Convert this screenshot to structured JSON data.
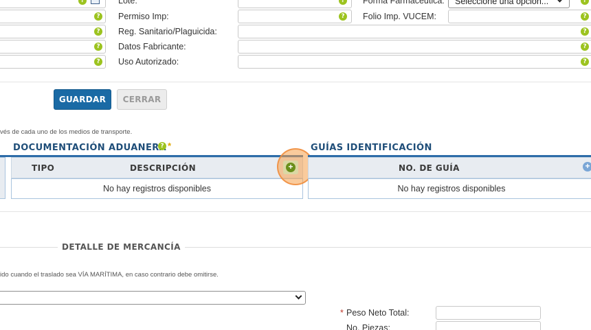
{
  "form": {
    "labels": {
      "lote": "Lote:",
      "permiso_imp": "Permiso Imp:",
      "reg_sanitario": "Reg. Sanitario/Plaguicida:",
      "datos_fabricante": "Datos Fabricante:",
      "uso_autorizado": "Uso Autorizado:",
      "forma_farmaceutica": "Forma Farmacéutica:",
      "folio_imp_vucem": "Folio Imp. VUCEM:"
    },
    "forma_farmaceutica_select": "Seleccione una opción...",
    "help_glyph": "?"
  },
  "buttons": {
    "guardar": "GUARDAR",
    "cerrar": "CERRAR"
  },
  "notes": {
    "transport": "vés de cada uno de los medios de transporte.",
    "maritima": "ido cuando el traslado sea VÍA MARÍTIMA, en caso contrario debe omitirse."
  },
  "documentacion": {
    "title": "DOCUMENTACIÓN ADUANERA",
    "required_mark": "*",
    "columns": [
      "TIPO",
      "DESCRIPCIÓN"
    ],
    "empty": "No hay registros disponibles",
    "add_glyph": "+"
  },
  "guias": {
    "title": "GUÍAS IDENTIFICACIÓN",
    "columns": [
      "NO. DE GUÍA"
    ],
    "empty": "No hay registros disponibles"
  },
  "detalle": {
    "legend": "DETALLE DE MERCANCÍA",
    "required_mark": "*",
    "peso_neto_label": "Peso Neto Total:",
    "no_piezas_label": "No. Piezas:"
  },
  "colors": {
    "accent": "#1a6aa5",
    "help": "#9cc31f",
    "highlight": "#f5a04a"
  }
}
